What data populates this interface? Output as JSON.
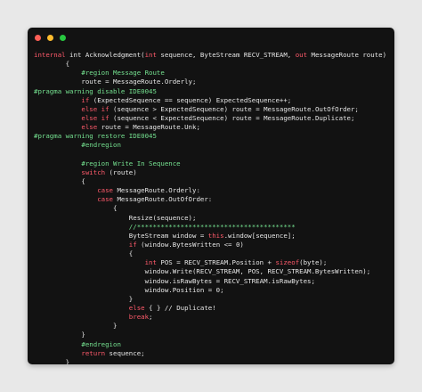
{
  "window": {
    "traffic_lights": [
      "close-dot",
      "minimize-dot",
      "zoom-dot"
    ],
    "colors": {
      "bg": "#121212",
      "keyword": "#ff5a6b",
      "directive": "#74e08f",
      "text": "#e6e6e6"
    }
  },
  "code": {
    "lines": [
      [
        {
          "t": "internal",
          "c": "kw"
        },
        {
          "t": " int Acknowledgment(",
          "c": "pl"
        },
        {
          "t": "int",
          "c": "kw"
        },
        {
          "t": " sequence, ByteStream RECV_STREAM, ",
          "c": "pl"
        },
        {
          "t": "out",
          "c": "kw"
        },
        {
          "t": " MessageRoute route)",
          "c": "pl"
        }
      ],
      [
        {
          "t": "        {",
          "c": "pl"
        }
      ],
      [
        {
          "t": "            #region Message Route",
          "c": "dir"
        }
      ],
      [
        {
          "t": "            route = MessageRoute.Orderly;",
          "c": "pl"
        }
      ],
      [
        {
          "t": "#pragma warning disable IDE0045",
          "c": "dir"
        }
      ],
      [
        {
          "t": "            ",
          "c": "pl"
        },
        {
          "t": "if",
          "c": "kw"
        },
        {
          "t": " (ExpectedSequence == sequence) ExpectedSequence++;",
          "c": "pl"
        }
      ],
      [
        {
          "t": "            ",
          "c": "pl"
        },
        {
          "t": "else if",
          "c": "kw"
        },
        {
          "t": " (sequence > ExpectedSequence) route = MessageRoute.OutOfOrder;",
          "c": "pl"
        }
      ],
      [
        {
          "t": "            ",
          "c": "pl"
        },
        {
          "t": "else if",
          "c": "kw"
        },
        {
          "t": " (sequence < ExpectedSequence) route = MessageRoute.Duplicate;",
          "c": "pl"
        }
      ],
      [
        {
          "t": "            ",
          "c": "pl"
        },
        {
          "t": "else",
          "c": "kw"
        },
        {
          "t": " route = MessageRoute.Unk;",
          "c": "pl"
        }
      ],
      [
        {
          "t": "#pragma warning restore IDE0045",
          "c": "dir"
        }
      ],
      [
        {
          "t": "            #endregion",
          "c": "dir"
        }
      ],
      [
        {
          "t": "",
          "c": "pl"
        }
      ],
      [
        {
          "t": "            #region Write In Sequence",
          "c": "dir"
        }
      ],
      [
        {
          "t": "            ",
          "c": "pl"
        },
        {
          "t": "switch",
          "c": "kw"
        },
        {
          "t": " (route)",
          "c": "pl"
        }
      ],
      [
        {
          "t": "            {",
          "c": "pl"
        }
      ],
      [
        {
          "t": "                ",
          "c": "pl"
        },
        {
          "t": "case",
          "c": "kw"
        },
        {
          "t": " MessageRoute.Orderly:",
          "c": "pl"
        }
      ],
      [
        {
          "t": "                ",
          "c": "pl"
        },
        {
          "t": "case",
          "c": "kw"
        },
        {
          "t": " MessageRoute.OutOfOrder:",
          "c": "pl"
        }
      ],
      [
        {
          "t": "                    {",
          "c": "pl"
        }
      ],
      [
        {
          "t": "                        Resize(sequence);",
          "c": "pl"
        }
      ],
      [
        {
          "t": "                        //****************************************",
          "c": "com"
        }
      ],
      [
        {
          "t": "                        ByteStream window = ",
          "c": "pl"
        },
        {
          "t": "this",
          "c": "kw"
        },
        {
          "t": ".window[sequence];",
          "c": "pl"
        }
      ],
      [
        {
          "t": "                        ",
          "c": "pl"
        },
        {
          "t": "if",
          "c": "kw"
        },
        {
          "t": " (window.BytesWritten <= 0)",
          "c": "pl"
        }
      ],
      [
        {
          "t": "                        {",
          "c": "pl"
        }
      ],
      [
        {
          "t": "                            ",
          "c": "pl"
        },
        {
          "t": "int",
          "c": "kw"
        },
        {
          "t": " POS = RECV_STREAM.Position + ",
          "c": "pl"
        },
        {
          "t": "sizeof",
          "c": "kw"
        },
        {
          "t": "(byte);",
          "c": "pl"
        }
      ],
      [
        {
          "t": "                            window.Write(RECV_STREAM, POS, RECV_STREAM.BytesWritten);",
          "c": "pl"
        }
      ],
      [
        {
          "t": "                            window.isRawBytes = RECV_STREAM.isRawBytes;",
          "c": "pl"
        }
      ],
      [
        {
          "t": "                            window.Position = 0;",
          "c": "pl"
        }
      ],
      [
        {
          "t": "                        }",
          "c": "pl"
        }
      ],
      [
        {
          "t": "                        ",
          "c": "pl"
        },
        {
          "t": "else",
          "c": "kw"
        },
        {
          "t": " { } // Duplicate!",
          "c": "pl"
        }
      ],
      [
        {
          "t": "                        ",
          "c": "pl"
        },
        {
          "t": "break",
          "c": "kw"
        },
        {
          "t": ";",
          "c": "pl"
        }
      ],
      [
        {
          "t": "                    }",
          "c": "pl"
        }
      ],
      [
        {
          "t": "            }",
          "c": "pl"
        }
      ],
      [
        {
          "t": "            #endregion",
          "c": "dir"
        }
      ],
      [
        {
          "t": "            ",
          "c": "pl"
        },
        {
          "t": "return",
          "c": "kw"
        },
        {
          "t": " sequence;",
          "c": "pl"
        }
      ],
      [
        {
          "t": "        }",
          "c": "pl"
        }
      ]
    ]
  }
}
